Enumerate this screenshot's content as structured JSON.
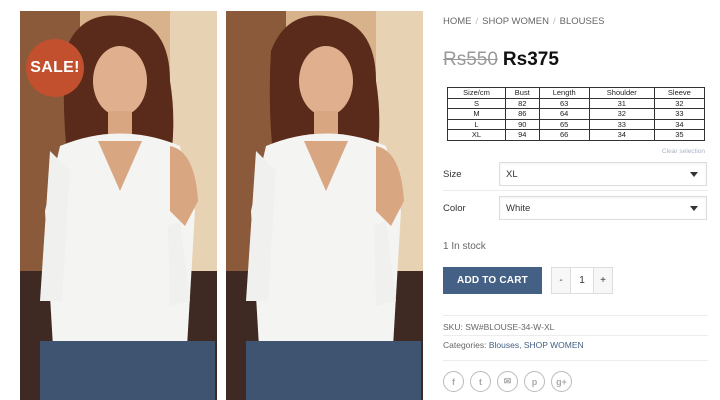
{
  "gallery": {
    "sale_badge": "SALE!"
  },
  "breadcrumb": {
    "items": [
      "HOME",
      "SHOP WOMEN",
      "BLOUSES"
    ]
  },
  "price": {
    "old": "Rs550",
    "new": "Rs375"
  },
  "size_chart": {
    "headers": [
      "Size/cm",
      "Bust",
      "Length",
      "Shoulder",
      "Sleeve"
    ],
    "rows": [
      [
        "S",
        "82",
        "63",
        "31",
        "32"
      ],
      [
        "M",
        "86",
        "64",
        "32",
        "33"
      ],
      [
        "L",
        "90",
        "65",
        "33",
        "34"
      ],
      [
        "XL",
        "94",
        "66",
        "34",
        "35"
      ]
    ]
  },
  "variations": {
    "clear_label": "Clear selection",
    "size_label": "Size",
    "size_value": "XL",
    "color_label": "Color",
    "color_value": "White"
  },
  "stock": "1 In stock",
  "cart": {
    "add_label": "ADD TO CART",
    "minus": "-",
    "quantity": "1",
    "plus": "+"
  },
  "meta": {
    "sku_label": "SKU:",
    "sku_value": "SW#BLOUSE-34-W-XL",
    "categories_label": "Categories:",
    "category_1": "Blouses",
    "category_2": "SHOP WOMEN"
  },
  "share": {
    "icons": [
      "facebook-icon",
      "twitter-icon",
      "email-icon",
      "pinterest-icon",
      "google-plus-icon"
    ],
    "glyphs": [
      "f",
      "t",
      "✉",
      "p",
      "g+"
    ]
  },
  "colors": {
    "accent": "#446084",
    "sale_badge": "#c2502f"
  }
}
